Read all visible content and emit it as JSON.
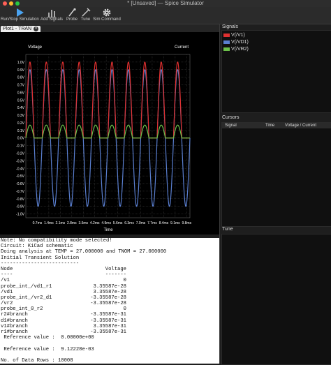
{
  "window": {
    "title": "* [Unsaved] — Spice Simulator"
  },
  "toolbar": {
    "items": [
      {
        "label": "Run/Stop Simulation",
        "icon": "play-icon"
      },
      {
        "label": "Add Signals",
        "icon": "add-signals-icon"
      },
      {
        "label": "Probe",
        "icon": "probe-icon"
      },
      {
        "label": "Tune",
        "icon": "tune-icon"
      },
      {
        "label": "Sim Command",
        "icon": "gear-icon"
      }
    ]
  },
  "tabs": [
    {
      "label": "Plot1 - TRAN"
    }
  ],
  "plot": {
    "left_axis_label": "Voltage",
    "right_axis_label": "Current",
    "x_axis_label": "Time"
  },
  "chart_data": {
    "type": "line",
    "xlabel": "Time",
    "ylabel": "Voltage",
    "ylim": [
      -1.05,
      1.1
    ],
    "xlim": [
      0,
      10
    ],
    "y_ticks": [
      "1.0V",
      "0.9V",
      "0.8V",
      "0.7V",
      "0.6V",
      "0.5V",
      "0.4V",
      "0.3V",
      "0.2V",
      "0.1V",
      "0.0V",
      "-0.1V",
      "-0.2V",
      "-0.3V",
      "-0.4V",
      "-0.5V",
      "-0.6V",
      "-0.7V",
      "-0.8V",
      "-0.9V",
      "-1.0V"
    ],
    "x_ticks": [
      "0.7ms",
      "1.4ms",
      "2.1ms",
      "2.8ms",
      "3.5ms",
      "4.2ms",
      "4.9ms",
      "5.6ms",
      "6.3ms",
      "7.0ms",
      "7.7ms",
      "8.4ms",
      "9.1ms",
      "9.8ms"
    ],
    "series": [
      {
        "name": "V(/V1)",
        "color": "#e03030",
        "amplitude": 1.0,
        "frequency_khz": 1.0,
        "half_wave": true
      },
      {
        "name": "V(/VD1)",
        "color": "#5a7fd0",
        "amplitude": 0.9,
        "frequency_khz": 1.0,
        "half_wave": false
      },
      {
        "name": "V(/VR2)",
        "color": "#6cc04a",
        "amplitude": 0.17,
        "frequency_khz": 1.0,
        "half_wave": true
      }
    ],
    "grid": true
  },
  "signals": {
    "title": "Signals",
    "items": [
      {
        "name": "V(/V1)",
        "color": "#e03030"
      },
      {
        "name": "V(/VD1)",
        "color": "#5a7fd0"
      },
      {
        "name": "V(/VR2)",
        "color": "#6cc04a"
      }
    ]
  },
  "cursors": {
    "title": "Cursors",
    "columns": [
      "Signal",
      "Time",
      "Voltage / Current"
    ]
  },
  "tune": {
    "title": "Tune"
  },
  "console": {
    "lines": [
      "Note: No compatibility mode selected!",
      "Circuit: KiCad schematic",
      "Doing analysis at TEMP = 27.000000 and TNOM = 27.000000",
      "Initial Transient Solution",
      "--------------------------"
    ],
    "table_header": {
      "node": "Node",
      "value": "Voltage"
    },
    "table_divider": {
      "node": "----",
      "value": "-------"
    },
    "rows": [
      {
        "node": "/v1",
        "value": "0"
      },
      {
        "node": "probe_int_/vd1_r1",
        "value": "3.35587e-28"
      },
      {
        "node": "/vd1",
        "value": "3.35587e-28"
      },
      {
        "node": "probe_int_/vr2_d1",
        "value": "-3.35587e-28"
      },
      {
        "node": "/vr2",
        "value": "-3.35587e-28"
      },
      {
        "node": "probe_int_0_r2",
        "value": "0"
      },
      {
        "node": "r2#branch",
        "value": "-3.35587e-31"
      },
      {
        "node": "d1#branch",
        "value": "-3.35587e-31"
      },
      {
        "node": "v1#branch",
        "value": "3.35587e-31"
      },
      {
        "node": "r1#branch",
        "value": "-3.35587e-31"
      }
    ],
    "footer": [
      " Reference value :  0.00000e+00",
      "",
      " Reference value :  9.12228e-03",
      "",
      "No. of Data Rows : 10008"
    ]
  }
}
